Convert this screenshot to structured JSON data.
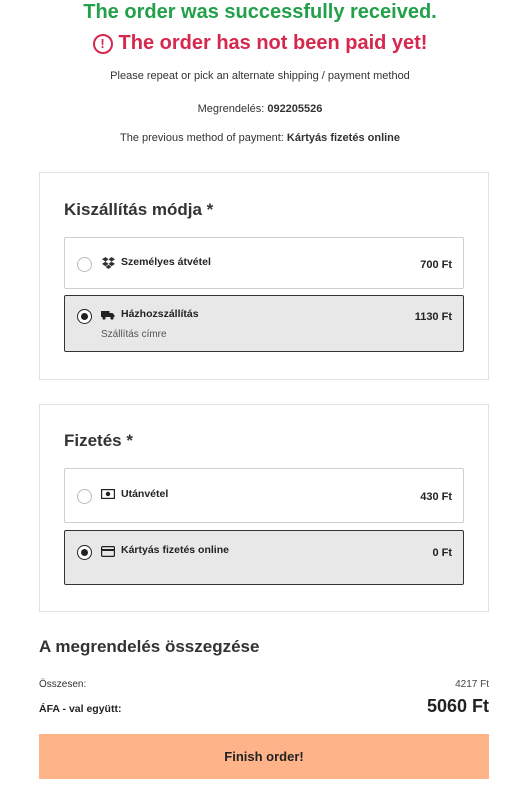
{
  "status": {
    "success": "The order was successfully received.",
    "unpaid": "The order has not been paid yet!",
    "instruction": "Please repeat or pick an alternate shipping / payment method",
    "order_label": "Megrendelés:",
    "order_number": "092205526",
    "prev_method_label": "The previous method of payment:",
    "prev_method_value": "Kártyás fizetés online"
  },
  "shipping": {
    "title": "Kiszállítás módja *",
    "options": [
      {
        "label": "Személyes átvétel",
        "price": "700 Ft",
        "icon": "dropbox-icon",
        "selected": false
      },
      {
        "label": "Házhozszállítás",
        "sub": "Szállítás címre",
        "price": "1130 Ft",
        "icon": "truck-icon",
        "selected": true
      }
    ]
  },
  "payment": {
    "title": "Fizetés *",
    "options": [
      {
        "label": "Utánvétel",
        "price": "430 Ft",
        "icon": "cash-icon",
        "selected": false
      },
      {
        "label": "Kártyás fizetés online",
        "price": "0 Ft",
        "icon": "credit-card-icon",
        "selected": true
      }
    ]
  },
  "summary": {
    "title": "A megrendelés összegzése",
    "total_label": "Összesen:",
    "total_value": "4217 Ft",
    "vat_label": "ÁFA - val együtt:",
    "vat_value": "5060 Ft"
  },
  "actions": {
    "finish_label": "Finish order!"
  },
  "colors": {
    "success": "#22a04a",
    "unpaid": "#d6284e",
    "button": "#ffb388"
  }
}
